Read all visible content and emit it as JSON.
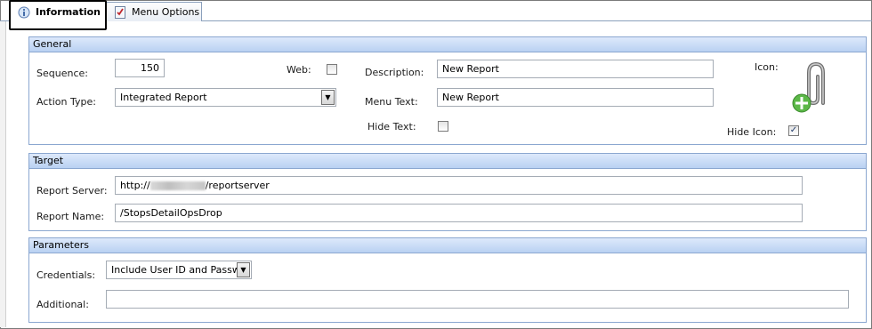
{
  "tabs": [
    {
      "label": "Information",
      "active": true,
      "icon": "info-icon"
    },
    {
      "label": "Menu Options",
      "active": false,
      "icon": "checklist-icon"
    }
  ],
  "general": {
    "header": "General",
    "sequence_label": "Sequence:",
    "sequence_value": "150",
    "web_label": "Web:",
    "web_checked": false,
    "description_label": "Description:",
    "description_value": "New Report",
    "icon_label": "Icon:",
    "icon_image": "paperclip-add-icon",
    "action_type_label": "Action Type:",
    "action_type_value": "Integrated Report",
    "menu_text_label": "Menu Text:",
    "menu_text_value": "New Report",
    "hide_text_label": "Hide Text:",
    "hide_text_checked": false,
    "hide_icon_label": "Hide Icon:",
    "hide_icon_checked": true
  },
  "target": {
    "header": "Target",
    "report_server_label": "Report Server:",
    "report_server_prefix": "http://",
    "report_server_suffix": "/reportserver",
    "report_name_label": "Report Name:",
    "report_name_value": "/StopsDetailOpsDrop"
  },
  "parameters": {
    "header": "Parameters",
    "credentials_label": "Credentials:",
    "credentials_value": "Include User ID and Passw",
    "additional_label": "Additional:",
    "additional_value": ""
  },
  "colors": {
    "section_header": "#c9dcf6",
    "section_border": "#8ba7d0",
    "accent_green": "#4caf50"
  }
}
